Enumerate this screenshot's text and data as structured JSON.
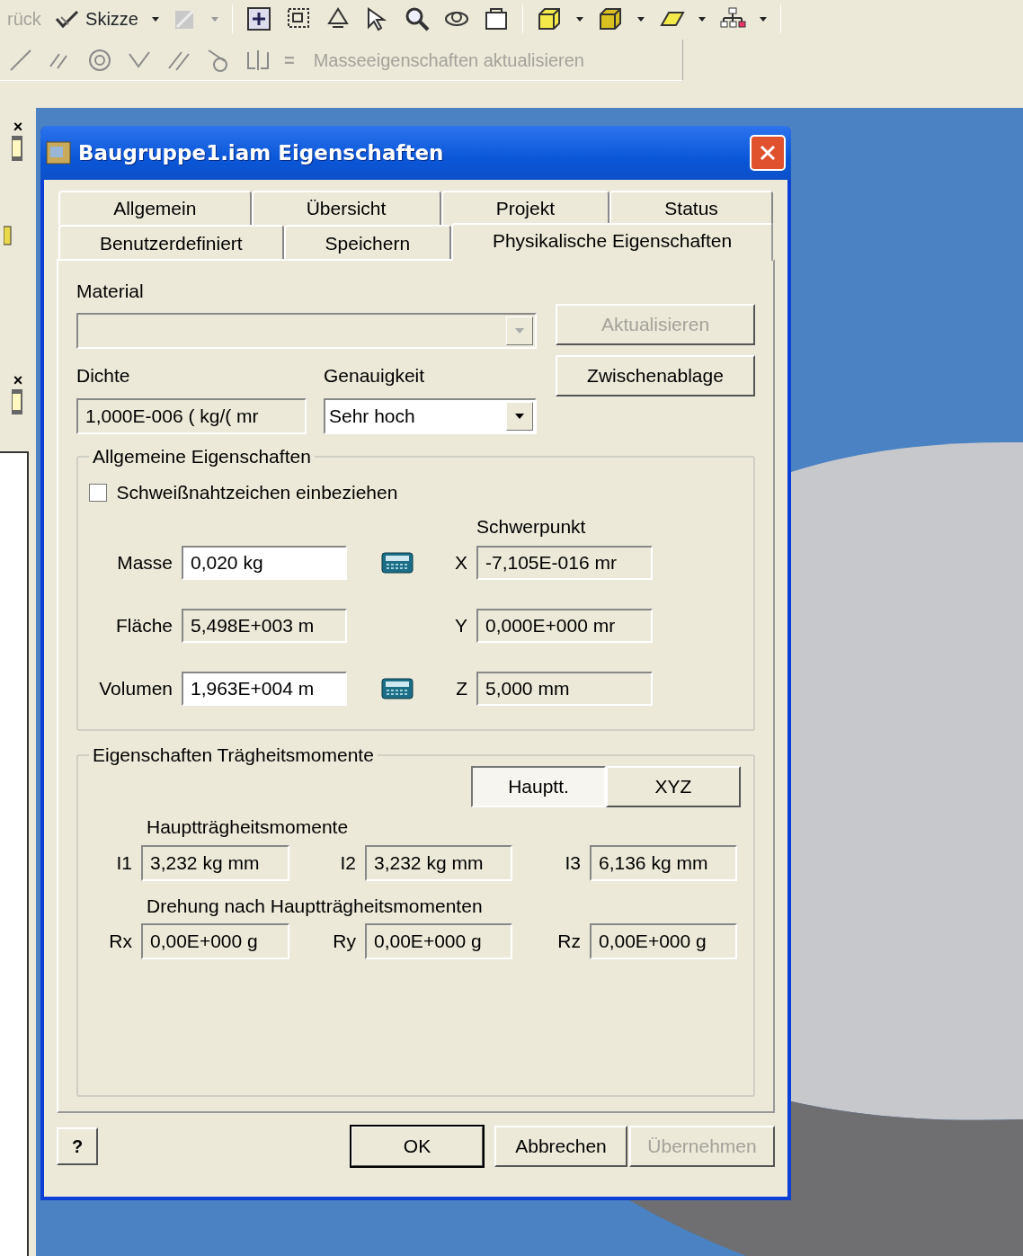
{
  "toolbar": {
    "back": {
      "label": "rück",
      "disabled": true
    },
    "sketch": {
      "label": "Skizze"
    },
    "update": {
      "symbol": "=",
      "label": "Masseeigenschaften aktualisieren",
      "disabled": true
    }
  },
  "side_panel": {
    "close_marks": [
      "×",
      "×"
    ]
  },
  "dialog": {
    "title": "Baugruppe1.iam Eigenschaften",
    "tab_rows": [
      [
        {
          "label": "Allgemein",
          "selected": false
        },
        {
          "label": "Übersicht",
          "selected": false
        },
        {
          "label": "Projekt",
          "selected": false
        },
        {
          "label": "Status",
          "selected": false
        }
      ],
      [
        {
          "label": "Benutzerdefiniert",
          "selected": false
        },
        {
          "label": "Speichern",
          "selected": false
        },
        {
          "label": "Physikalische Eigenschaften",
          "selected": true
        }
      ]
    ],
    "material": {
      "label": "Material",
      "disabled": true
    },
    "density": {
      "label": "Dichte",
      "value": "1,000E-006 ( kg/( mr"
    },
    "accuracy": {
      "label": "Genauigkeit",
      "value": "Sehr hoch"
    },
    "side_buttons": [
      {
        "label": "Aktualisieren",
        "disabled": true
      },
      {
        "label": "Zwischenablage",
        "disabled": false
      }
    ],
    "general": {
      "title": "Allgemeine Eigenschaften",
      "checkbox": {
        "label": "Schweißnahtzeichen einbeziehen",
        "checked": false
      },
      "centroid_label": "Schwerpunkt",
      "rows": [
        {
          "label": "Masse",
          "value": "0,020 kg",
          "editable": true,
          "calculator": true,
          "axis": "X",
          "centroid": "-7,105E-016 mr"
        },
        {
          "label": "Fläche",
          "value": "5,498E+003 m",
          "editable": false,
          "calculator": false,
          "axis": "Y",
          "centroid": "0,000E+000 mr"
        },
        {
          "label": "Volumen",
          "value": "1,963E+004 m",
          "editable": true,
          "calculator": true,
          "axis": "Z",
          "centroid": "5,000 mm"
        }
      ]
    },
    "inertia": {
      "title": "Eigenschaften Trägheitsmomente",
      "modes": [
        {
          "label": "Hauptt.",
          "selected": true
        },
        {
          "label": "XYZ",
          "selected": false
        }
      ],
      "principal_label": "Hauptträgheitsmomente",
      "moments": [
        {
          "label": "I1",
          "value": "3,232 kg mm"
        },
        {
          "label": "I2",
          "value": "3,232 kg mm"
        },
        {
          "label": "I3",
          "value": "6,136 kg mm"
        }
      ],
      "rotation_label": "Drehung nach Hauptträgheitsmomenten",
      "rotations": [
        {
          "label": "Rx",
          "value": "0,00E+000 g"
        },
        {
          "label": "Ry",
          "value": "0,00E+000 g"
        },
        {
          "label": "Rz",
          "value": "0,00E+000 g"
        }
      ]
    },
    "help_symbol": "?",
    "buttons": [
      {
        "label": "OK",
        "default": true,
        "disabled": false
      },
      {
        "label": "Abbrechen",
        "default": false,
        "disabled": false
      },
      {
        "label": "Übernehmen",
        "default": false,
        "disabled": true
      }
    ]
  }
}
